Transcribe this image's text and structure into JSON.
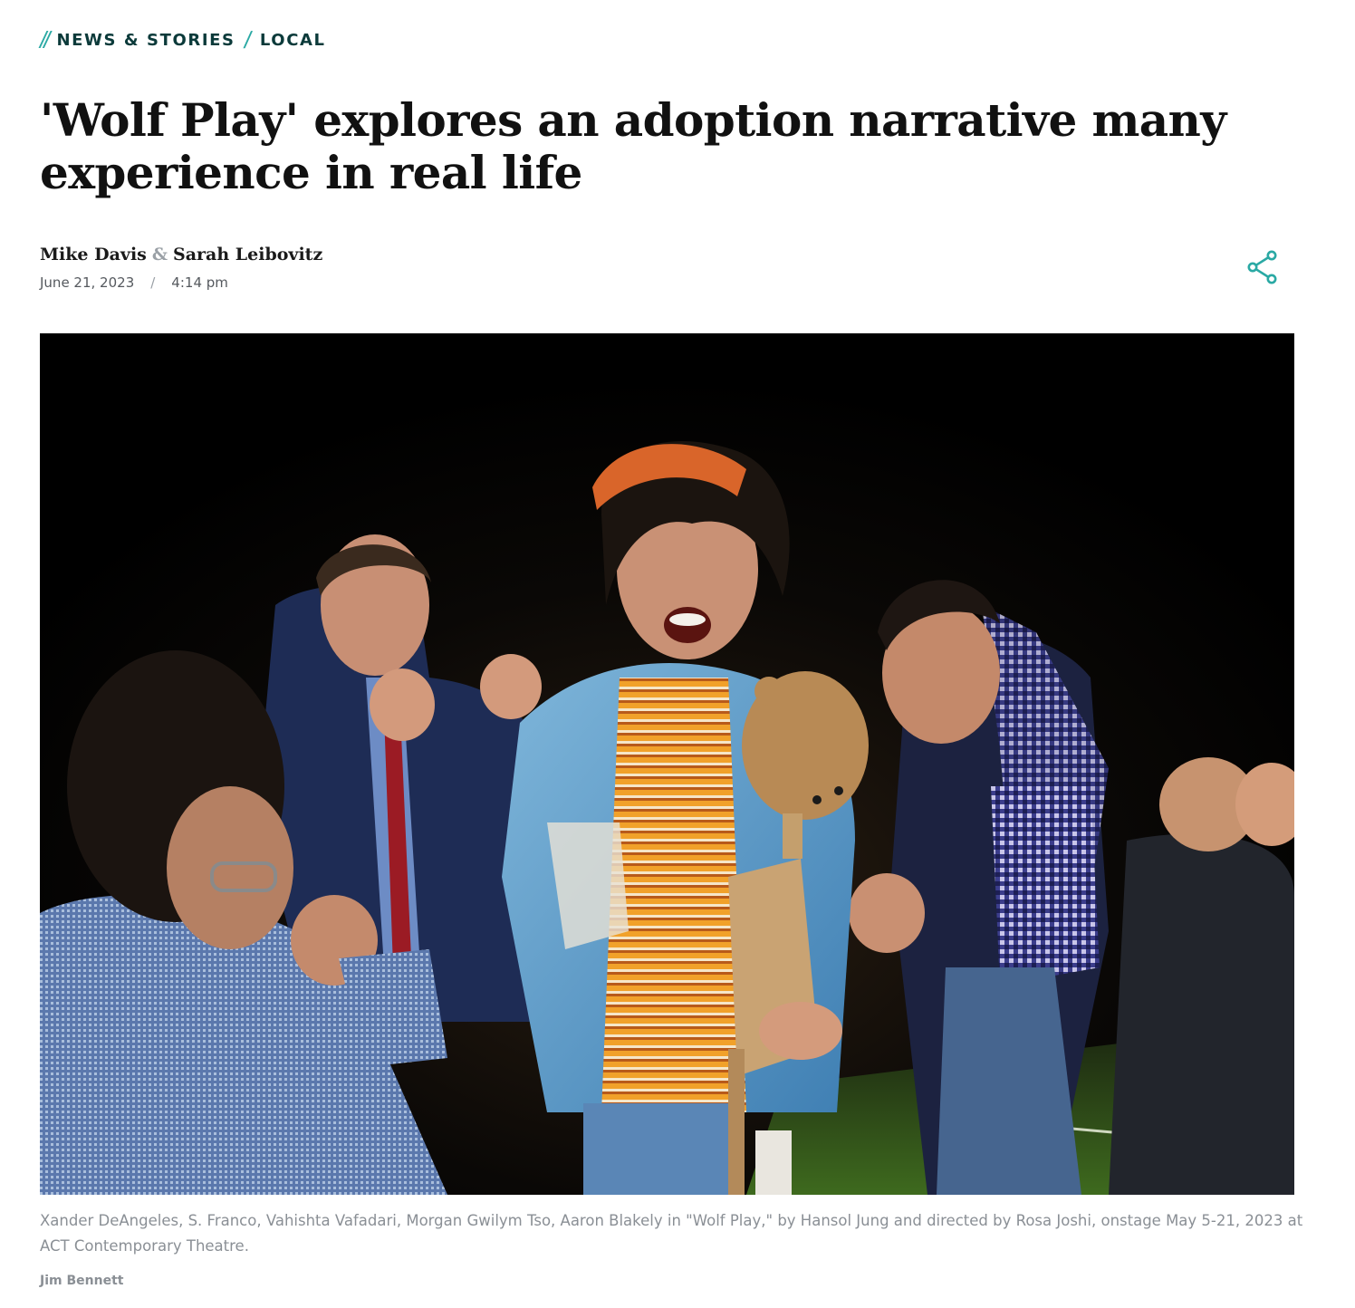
{
  "breadcrumb": {
    "items": [
      {
        "label": "NEWS & STORIES"
      },
      {
        "label": "LOCAL"
      }
    ]
  },
  "article": {
    "title": "'Wolf Play' explores an adoption narrative many experience in real life",
    "authors": [
      {
        "name": "Mike Davis"
      },
      {
        "name": "Sarah Leibovitz"
      }
    ],
    "author_separator": "&",
    "date": "June 21, 2023",
    "date_separator": "/",
    "time": "4:14 pm",
    "share_icon": "share-icon"
  },
  "photo": {
    "caption": "Xander DeAngeles, S. Franco, Vahishta Vafadari, Morgan Gwilym Tso, Aaron Blakely in \"Wolf Play,\" by Hansol Jung and directed by Rosa Joshi, onstage May 5-21, 2023 at ACT Contemporary Theatre.",
    "credit": "Jim Bennett"
  },
  "colors": {
    "accent": "#2aa9a4",
    "breadcrumb_text": "#0b3a3a",
    "title_text": "#111111",
    "caption_text": "#8a8f95"
  }
}
